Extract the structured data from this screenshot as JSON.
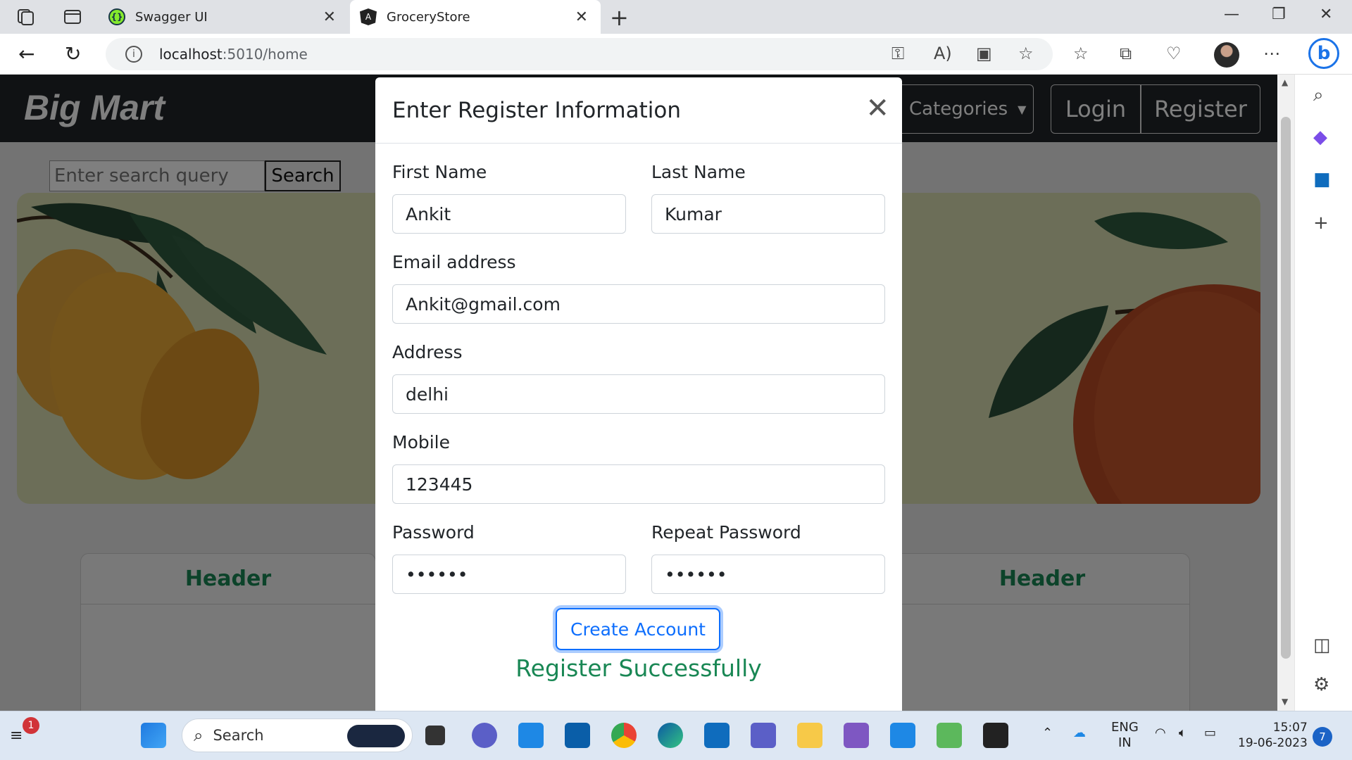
{
  "browser": {
    "tabs": [
      {
        "label": "Swagger UI",
        "active": false
      },
      {
        "label": "GroceryStore",
        "active": true
      }
    ],
    "url_host": "localhost",
    "url_path": ":5010/home"
  },
  "site": {
    "brand": "Big Mart",
    "nav": {
      "categories": "Categories",
      "login": "Login",
      "register": "Register"
    },
    "search": {
      "placeholder": "Enter search query",
      "button": "Search"
    },
    "cards": [
      {
        "header": "Header"
      },
      {
        "header": "Header"
      }
    ]
  },
  "modal": {
    "title": "Enter Register Information",
    "fields": {
      "first_name": {
        "label": "First Name",
        "value": "Ankit"
      },
      "last_name": {
        "label": "Last Name",
        "value": "Kumar"
      },
      "email": {
        "label": "Email address",
        "value": "Ankit@gmail.com"
      },
      "address": {
        "label": "Address",
        "value": "delhi"
      },
      "mobile": {
        "label": "Mobile",
        "value": "123445"
      },
      "password": {
        "label": "Password",
        "value": "••••••"
      },
      "repeat_password": {
        "label": "Repeat Password",
        "value": "••••••"
      }
    },
    "create_button": "Create Account",
    "success_message": "Register Successfully"
  },
  "taskbar": {
    "search_label": "Search",
    "notification_count": "1",
    "lang_primary": "ENG",
    "lang_secondary": "IN",
    "time": "15:07",
    "date": "19-06-2023",
    "notification_center_count": "7"
  },
  "colors": {
    "navbar": "#212529",
    "success": "#198754",
    "primary": "#0d6efd",
    "banner": "#d8ddb1"
  }
}
